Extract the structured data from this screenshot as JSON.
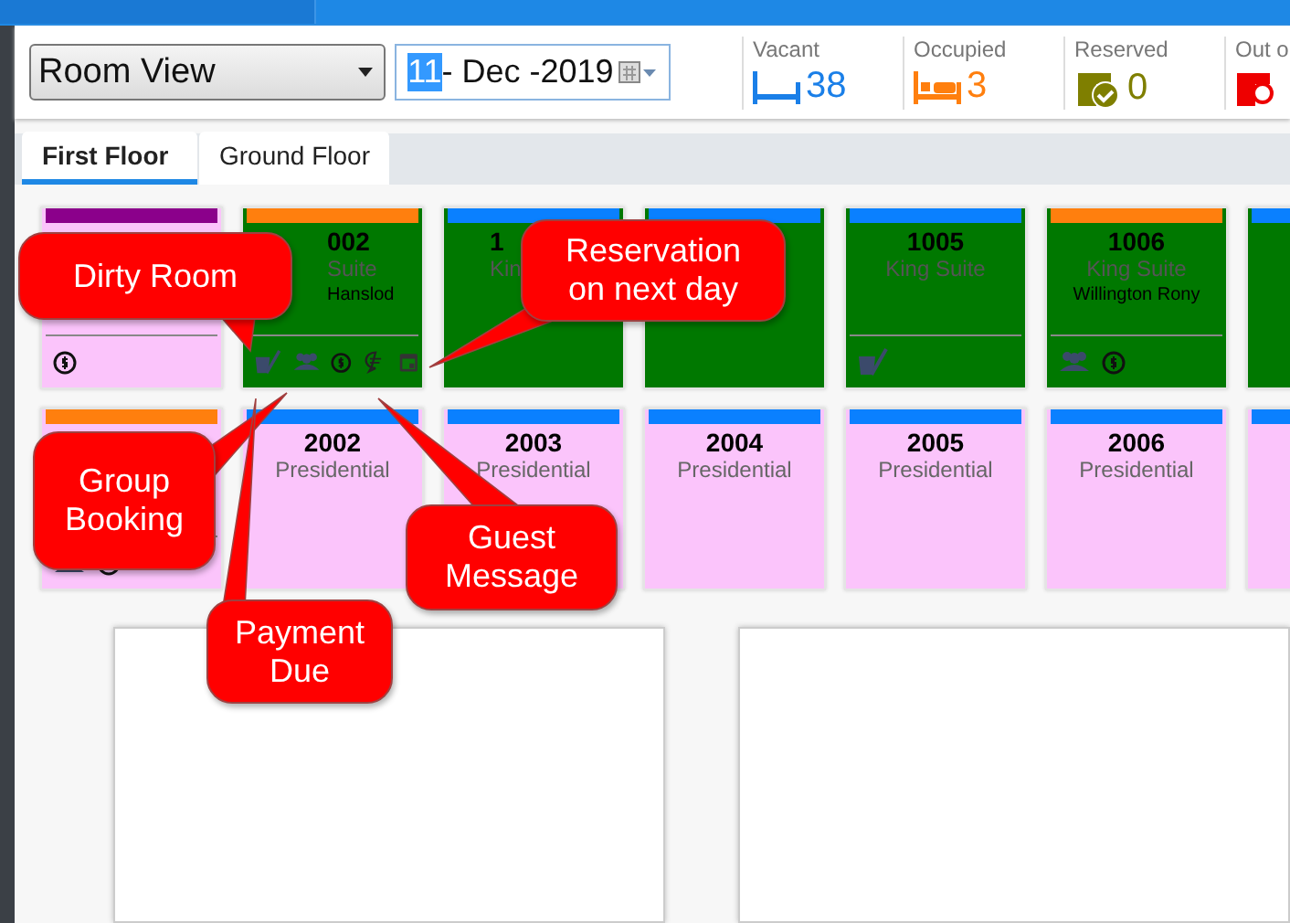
{
  "view_select": {
    "value": "Room View"
  },
  "date_field": {
    "day": "11",
    "rest": "- Dec -2019",
    "day_selected": true
  },
  "stats": [
    {
      "kind": "vacant",
      "label": "Vacant",
      "value": "38",
      "color": "#1a7fe8"
    },
    {
      "kind": "occupied",
      "label": "Occupied",
      "value": "3",
      "color": "#ff7f0e"
    },
    {
      "kind": "reserved",
      "label": "Reserved",
      "value": "0",
      "color": "#7f7f00"
    },
    {
      "kind": "out",
      "label": "Out o",
      "color": "#ee0000"
    }
  ],
  "tabs": [
    {
      "label": "First Floor",
      "selected": true
    },
    {
      "label": "Ground Floor",
      "selected": false
    }
  ],
  "room_rows": [
    [
      {
        "kind": "vacant",
        "color": "#8b008b",
        "icons": [
          {
            "kind": "payment"
          }
        ]
      },
      {
        "kind": "occupied",
        "color": "#ff7f0e",
        "number": "002",
        "type": "Suite",
        "guest": "Hanslod",
        "icons": [
          {
            "kind": "dirty"
          },
          {
            "kind": "group"
          },
          {
            "kind": "payment"
          },
          {
            "kind": "message"
          },
          {
            "kind": "calendar"
          }
        ]
      },
      {
        "kind": "occupied",
        "color": "#0a80ff",
        "number": "1",
        "type": "Kin"
      },
      {
        "kind": "occupied",
        "color": "#0a80ff"
      },
      {
        "kind": "occupied",
        "color": "#0a80ff",
        "number": "1005",
        "type": "King Suite",
        "icons": [
          {
            "kind": "dirty"
          }
        ]
      },
      {
        "kind": "occupied",
        "color": "#ff7f0e",
        "number": "1006",
        "type": "King Suite",
        "guest": "Willington Rony",
        "icons": [
          {
            "kind": "group"
          },
          {
            "kind": "payment"
          }
        ]
      },
      {
        "kind": "occupied",
        "color": "#0a80ff"
      }
    ],
    [
      {
        "kind": "vacant",
        "color": "#ff7f0e",
        "icons": [
          {
            "kind": "group"
          },
          {
            "kind": "payment"
          }
        ]
      },
      {
        "kind": "vacant",
        "color": "#0a80ff",
        "number": "2002",
        "type": "Presidential"
      },
      {
        "kind": "vacant",
        "color": "#0a80ff",
        "number": "2003",
        "type": "Presidential"
      },
      {
        "kind": "vacant",
        "color": "#0a80ff",
        "number": "2004",
        "type": "Presidential"
      },
      {
        "kind": "vacant",
        "color": "#0a80ff",
        "number": "2005",
        "type": "Presidential"
      },
      {
        "kind": "vacant",
        "color": "#0a80ff",
        "number": "2006",
        "type": "Presidential"
      },
      {
        "kind": "vacant",
        "color": "#0a80ff"
      }
    ]
  ],
  "callouts": [
    {
      "text": "Dirty Room"
    },
    {
      "text": "Reservation on next day"
    },
    {
      "text": "Group Booking"
    },
    {
      "text": "Payment Due"
    },
    {
      "text": "Guest Message"
    }
  ]
}
